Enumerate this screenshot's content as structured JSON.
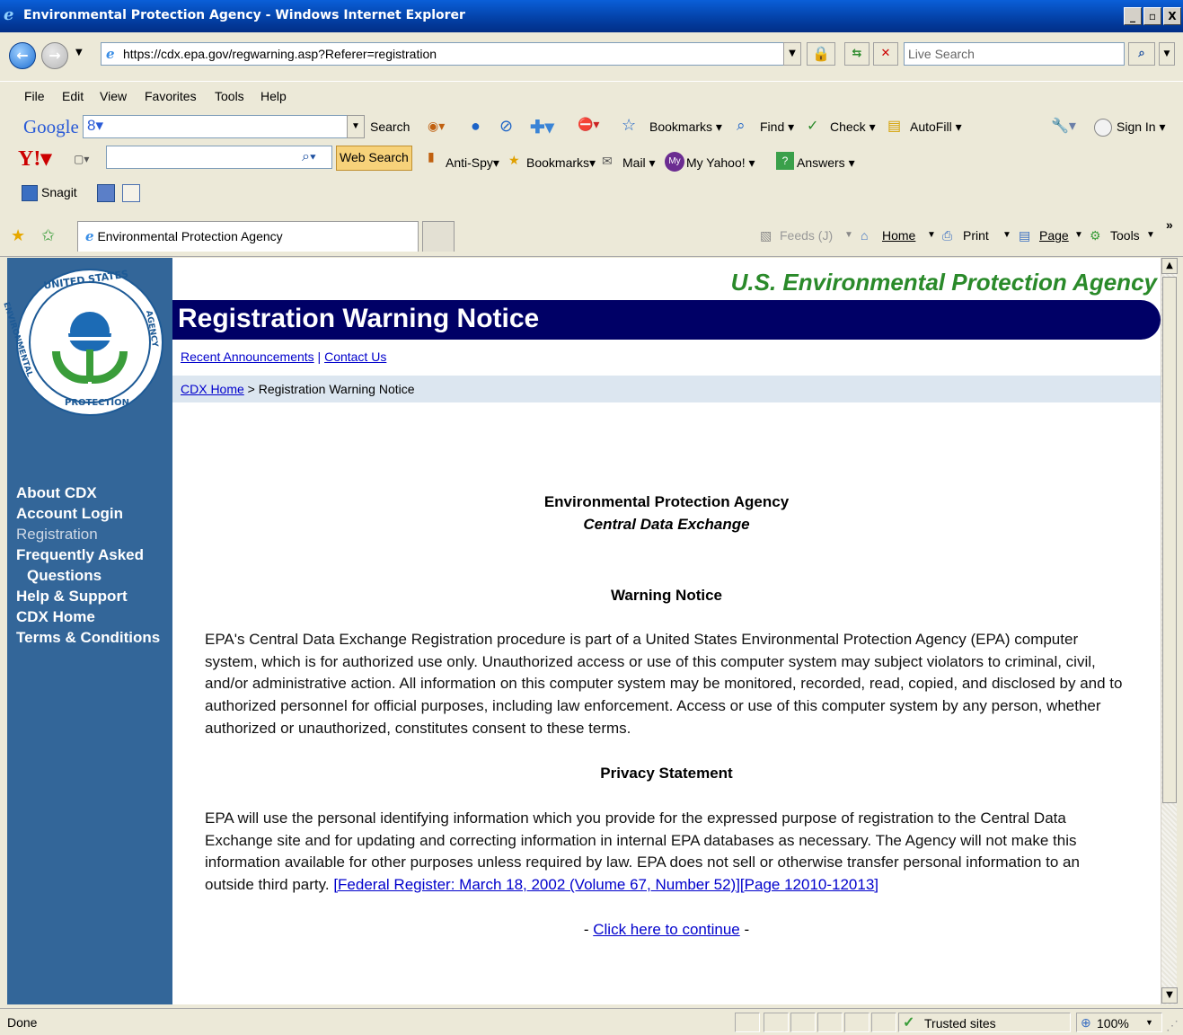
{
  "window": {
    "title": "Environmental Protection Agency - Windows Internet Explorer",
    "minimize": "_",
    "maximize": "▫",
    "close": "X"
  },
  "address": {
    "url": "https://cdx.epa.gov/regwarning.asp?Referer=registration",
    "search_placeholder": "Live Search"
  },
  "menu": [
    "File",
    "Edit",
    "View",
    "Favorites",
    "Tools",
    "Help"
  ],
  "google_toolbar": {
    "brand": "Google",
    "search": "Search",
    "bookmarks": "Bookmarks",
    "find": "Find",
    "check": "Check",
    "autofill": "AutoFill",
    "signin": "Sign In"
  },
  "yahoo_toolbar": {
    "web_search": "Web Search",
    "antispy": "Anti-Spy",
    "bookmarks": "Bookmarks",
    "mail": "Mail",
    "myyahoo": "My Yahoo!",
    "answers": "Answers"
  },
  "snagit_toolbar": {
    "label": "Snagit"
  },
  "tab": {
    "title": "Environmental Protection Agency"
  },
  "command_bar": {
    "feeds": "Feeds (J)",
    "home": "Home",
    "print": "Print",
    "page": "Page",
    "tools": "Tools",
    "more": "»"
  },
  "seal": {
    "top_text": "UNITED STATES",
    "left_text": "ENVIRONMENTAL",
    "right_text": "AGENCY",
    "bottom_text": "PROTECTION"
  },
  "sidebar": {
    "items": [
      {
        "label": "About CDX"
      },
      {
        "label": "Account Login"
      },
      {
        "label": "Registration"
      },
      {
        "label": "Frequently Asked"
      },
      {
        "label": "Questions"
      },
      {
        "label": "Help & Support"
      },
      {
        "label": "CDX Home"
      },
      {
        "label": "Terms & Conditions"
      }
    ]
  },
  "page": {
    "agency": "U.S. Environmental Protection Agency",
    "banner_title": "Registration Warning Notice",
    "recent_announcements": "Recent Announcements",
    "separator": "|",
    "contact_us": "Contact Us",
    "breadcrumb_home": "CDX Home",
    "breadcrumb_rest": " > Registration Warning Notice",
    "org_name": "Environmental Protection Agency",
    "org_sub": "Central Data Exchange",
    "warning_heading": "Warning Notice",
    "warning_text": "EPA's Central Data Exchange Registration procedure is part of a United States Environmental Protection Agency (EPA) computer system, which is for authorized use only. Unauthorized access or use of this computer system may subject violators to criminal, civil, and/or administrative action. All information on this computer system may be monitored, recorded, read, copied, and disclosed by and to authorized personnel for official purposes, including law enforcement. Access or use of this computer system by any person, whether authorized or unauthorized, constitutes consent to these terms.",
    "privacy_heading": "Privacy Statement",
    "privacy_text": "EPA will use the personal identifying information which you provide for the expressed purpose of registration to the Central Data Exchange site and for updating and correcting information in internal EPA databases as necessary. The Agency will not make this information available for other purposes unless required by law. EPA does not sell or otherwise transfer personal information to an outside third party.",
    "federal_register_link": "[Federal Register: March 18, 2002 (Volume 67, Number 52)][Page 12010-12013]",
    "continue_prefix": "- ",
    "continue_link": "Click here to continue",
    "continue_suffix": " -"
  },
  "status": {
    "text": "Done",
    "zone": "Trusted sites",
    "zoom": "100%"
  },
  "colors": {
    "sidebar": "#336699",
    "banner": "#000066",
    "agency_green": "#2a8a2a",
    "link": "#0000cc"
  }
}
